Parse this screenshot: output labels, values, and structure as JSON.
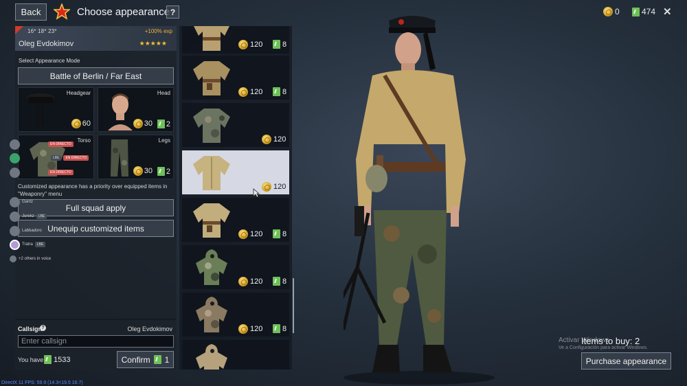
{
  "header": {
    "back_label": "Back",
    "title": "Choose appearance",
    "help_label": "?",
    "gold": "0",
    "tickets": "474",
    "close_label": "✕"
  },
  "profile": {
    "stats": "16* 18* 23*",
    "exp": "+100% exp",
    "name": "Oleg Evdokimov",
    "stars": "★★★★★"
  },
  "appearance": {
    "mode_label": "Select Appearance Mode",
    "mode_value": "Battle of Berlin / Far East",
    "slots": [
      {
        "label": "Headgear",
        "gold": "60"
      },
      {
        "label": "Head",
        "gold": "30",
        "tickets": "2"
      },
      {
        "label": "Torso"
      },
      {
        "label": "Legs",
        "gold": "30",
        "tickets": "2"
      }
    ],
    "priority_note": "Customized appearance has a priority over equipped items in \"Weaponry\" menu",
    "full_squad_label": "Full squad apply",
    "unequip_label": "Unequip customized items"
  },
  "voice": {
    "badges": [
      "EN DIRECTO",
      "EN DIRECTO",
      "EN DIRECTO",
      "LBE",
      "LBE",
      "LBE"
    ],
    "names": [
      "Gantz",
      "Jurekz",
      "Labbadoro",
      "Tratra"
    ],
    "others": "+2 others in voice"
  },
  "callsign": {
    "label": "Callsign",
    "help": "?",
    "owner": "Oleg Evdokimov",
    "placeholder": "Enter callsign",
    "you_have_label": "You have",
    "you_have_value": "1533",
    "confirm_label": "Confirm",
    "confirm_cost": "1"
  },
  "items": [
    {
      "gold": "120",
      "tickets": "8"
    },
    {
      "gold": "120",
      "tickets": "8"
    },
    {
      "gold": "120"
    },
    {
      "gold": "120",
      "selected": true
    },
    {
      "gold": "120",
      "tickets": "8"
    },
    {
      "gold": "120",
      "tickets": "8"
    },
    {
      "gold": "120",
      "tickets": "8"
    },
    {}
  ],
  "purchase": {
    "items_to_buy": "Items to buy: 2",
    "button_label": "Purchase appearance"
  },
  "system": {
    "activate": "Activar Windows",
    "activate_sub": "Ve a Configuración para activar Windows.",
    "fps": "DirectX 11 FPS: 59.9 (14.3<19.5 16.7)"
  }
}
